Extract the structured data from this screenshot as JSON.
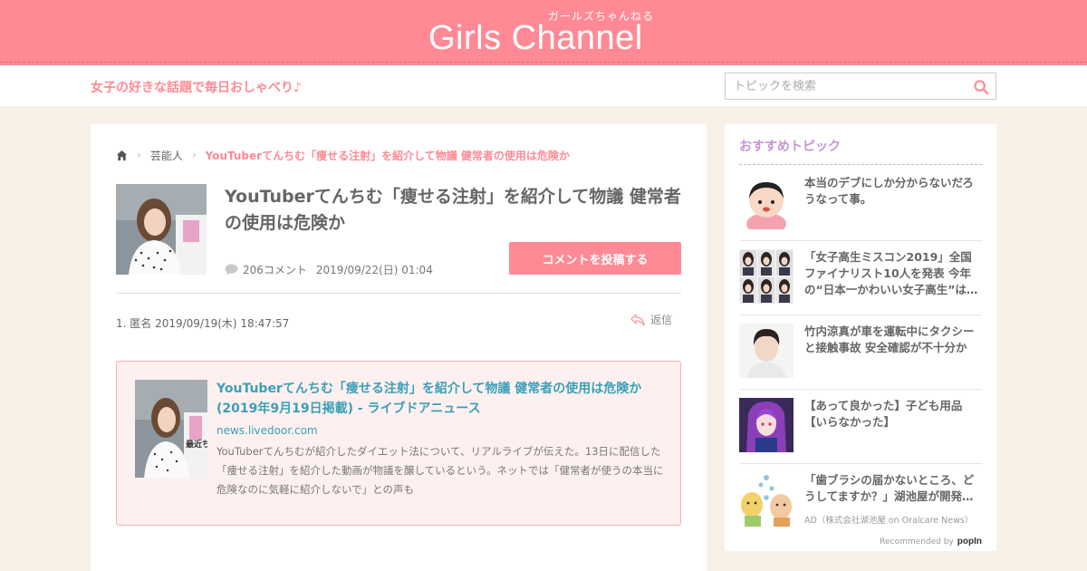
{
  "header": {
    "logo_text": "Girls Channel",
    "logo_kana": "ガールズちゃんねる",
    "tagline": "女子の好きな話題で毎日おしゃべり♪"
  },
  "search": {
    "placeholder": "トピックを検索"
  },
  "breadcrumb": {
    "category": "芸能人",
    "current": "YouTuberてんちむ「痩せる注射」を紹介して物議 健常者の使用は危険か"
  },
  "topic": {
    "title": "YouTuberてんちむ「痩せる注射」を紹介して物議 健常者の使用は危険か",
    "comment_count": "206コメント",
    "date": "2019/09/22(日) 01:04",
    "post_button": "コメントを投稿する"
  },
  "comment": {
    "header": "1. 匿名 2019/09/19(木) 18:47:57",
    "reply_label": "返信",
    "link_card": {
      "title": "YouTuberてんちむ「痩せる注射」を紹介して物議 健常者の使用は危険か (2019年9月19日掲載) - ライブドアニュース",
      "domain": "news.livedoor.com",
      "description": "YouTuberてんちむが紹介したダイエット法について、リアルライブが伝えた。13日に配信した「痩せる注射」を紹介した動画が物議を醸しているという。ネットでは「健常者が使うの本当に危険なのに気軽に紹介しないで」との声も",
      "thumb_sign_text": "最近ちん"
    }
  },
  "sidebar": {
    "title": "おすすめトピック",
    "items": [
      {
        "text": "本当のデブにしか分からないだろうなって事。"
      },
      {
        "text": "「女子高生ミスコン2019」全国ファイナリスト10人を発表 今年の“日本一かわいい女子高生”は…"
      },
      {
        "text": "竹内涼真が車を運転中にタクシーと接触事故 安全確認が不十分か"
      },
      {
        "text": "【あって良かった】子ども用品【いらなかった】"
      },
      {
        "text": "「歯ブラシの届かないところ、どうしてますか？」湖池屋が開発…",
        "ad": "AD（株式会社湖池屋 on Oralcare News）"
      }
    ],
    "recommended_label": "Recommended by",
    "recommended_brand": "popIn"
  },
  "colors": {
    "brand_pink": "#ff8a95",
    "link_blue": "#3aa0b8",
    "sidebar_title": "#c695d6",
    "page_bg": "#f8f1e8"
  }
}
